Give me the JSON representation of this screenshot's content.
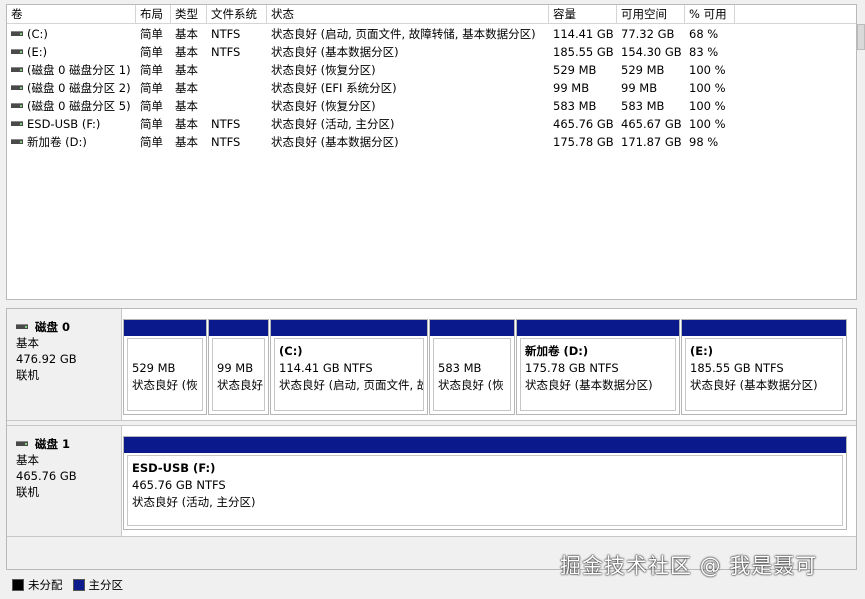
{
  "volume_list": {
    "columns": [
      "卷",
      "布局",
      "类型",
      "文件系统",
      "状态",
      "容量",
      "可用空间",
      "% 可用"
    ],
    "rows": [
      {
        "volume": "(C:)",
        "layout": "简单",
        "type": "基本",
        "fs": "NTFS",
        "status": "状态良好 (启动, 页面文件, 故障转储, 基本数据分区)",
        "capacity": "114.41 GB",
        "free": "77.32 GB",
        "pct": "68 %"
      },
      {
        "volume": "(E:)",
        "layout": "简单",
        "type": "基本",
        "fs": "NTFS",
        "status": "状态良好 (基本数据分区)",
        "capacity": "185.55 GB",
        "free": "154.30 GB",
        "pct": "83 %"
      },
      {
        "volume": "(磁盘 0 磁盘分区 1)",
        "layout": "简单",
        "type": "基本",
        "fs": "",
        "status": "状态良好 (恢复分区)",
        "capacity": "529 MB",
        "free": "529 MB",
        "pct": "100 %"
      },
      {
        "volume": "(磁盘 0 磁盘分区 2)",
        "layout": "简单",
        "type": "基本",
        "fs": "",
        "status": "状态良好 (EFI 系统分区)",
        "capacity": "99 MB",
        "free": "99 MB",
        "pct": "100 %"
      },
      {
        "volume": "(磁盘 0 磁盘分区 5)",
        "layout": "简单",
        "type": "基本",
        "fs": "",
        "status": "状态良好 (恢复分区)",
        "capacity": "583 MB",
        "free": "583 MB",
        "pct": "100 %"
      },
      {
        "volume": "ESD-USB (F:)",
        "layout": "简单",
        "type": "基本",
        "fs": "NTFS",
        "status": "状态良好 (活动, 主分区)",
        "capacity": "465.76 GB",
        "free": "465.67 GB",
        "pct": "100 %"
      },
      {
        "volume": "新加卷 (D:)",
        "layout": "简单",
        "type": "基本",
        "fs": "NTFS",
        "status": "状态良好 (基本数据分区)",
        "capacity": "175.78 GB",
        "free": "171.87 GB",
        "pct": "98 %"
      }
    ]
  },
  "disks": [
    {
      "name": "磁盘 0",
      "type": "基本",
      "size": "476.92 GB",
      "state": "联机",
      "partitions": [
        {
          "label": "",
          "size": "529 MB",
          "status": "状态良好 (恢"
        },
        {
          "label": "",
          "size": "99 MB",
          "status": "状态良好"
        },
        {
          "label": "(C:)",
          "size": "114.41 GB NTFS",
          "status": "状态良好 (启动, 页面文件, 故"
        },
        {
          "label": "",
          "size": "583 MB",
          "status": "状态良好 (恢"
        },
        {
          "label": "新加卷 (D:)",
          "size": "175.78 GB NTFS",
          "status": "状态良好 (基本数据分区)"
        },
        {
          "label": "(E:)",
          "size": "185.55 GB NTFS",
          "status": "状态良好 (基本数据分区)"
        }
      ]
    },
    {
      "name": "磁盘 1",
      "type": "基本",
      "size": "465.76 GB",
      "state": "联机",
      "partitions": [
        {
          "label": "ESD-USB (F:)",
          "size": "465.76 GB NTFS",
          "status": "状态良好 (活动, 主分区)"
        }
      ]
    }
  ],
  "legend": [
    {
      "label": "未分配",
      "color": "#000000"
    },
    {
      "label": "主分区",
      "color": "#0a1a8c"
    }
  ],
  "watermark": "掘金技术社区 @ 我是聂可",
  "icons": {
    "drive": "drive-icon"
  }
}
